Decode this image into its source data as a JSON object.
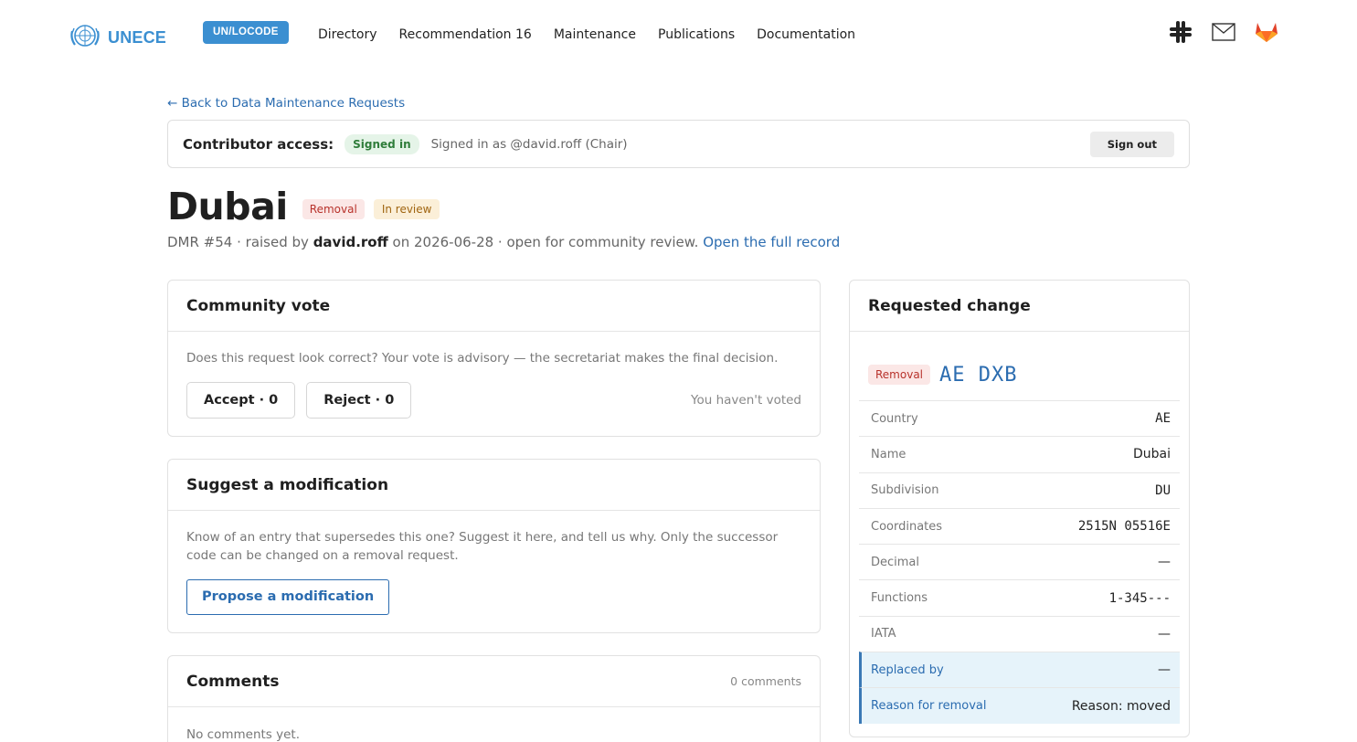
{
  "nav": {
    "logo_text": "UNECE",
    "badge": "UN/LOCODE",
    "links": [
      "Directory",
      "Recommendation 16",
      "Maintenance",
      "Publications",
      "Documentation"
    ],
    "icons": [
      "slack-icon",
      "mail-icon",
      "gitlab-icon"
    ]
  },
  "back_link": "← Back to Data Maintenance Requests",
  "access": {
    "label": "Contributor access:",
    "status": "Signed in",
    "user": "Signed in as @david.roff (Chair)",
    "signout": "Sign out"
  },
  "request": {
    "title": "Dubai",
    "type_badge": "Removal",
    "status_badge": "In review",
    "dmr": "DMR #54",
    "raised_by_prefix": " · raised by ",
    "author": "david.roff",
    "date_text": " on 2026-06-28 · open for community review. ",
    "record_link": "Open the full record"
  },
  "vote": {
    "title": "Community vote",
    "description": "Does this request look correct? Your vote is advisory — the secretariat makes the final decision.",
    "accept": "Accept · 0",
    "reject": "Reject · 0",
    "status": "You haven't voted"
  },
  "suggest": {
    "title": "Suggest a modification",
    "description": "Know of an entry that supersedes this one? Suggest it here, and tell us why. Only the successor code can be changed on a removal request.",
    "button": "Propose a modification"
  },
  "comments": {
    "title": "Comments",
    "count": "0 comments",
    "empty": "No comments yet."
  },
  "change": {
    "title": "Requested change",
    "badge": "Removal",
    "code": "AE DXB",
    "fields": [
      {
        "label": "Country",
        "value": "AE"
      },
      {
        "label": "Name",
        "value": "Dubai"
      },
      {
        "label": "Subdivision",
        "value": "DU"
      },
      {
        "label": "Coordinates",
        "value": "2515N 05516E"
      },
      {
        "label": "Decimal",
        "value": "—"
      },
      {
        "label": "Functions",
        "value": "1-345---"
      },
      {
        "label": "IATA",
        "value": "—"
      },
      {
        "label": "Replaced by",
        "value": "—"
      },
      {
        "label": "Reason for removal",
        "value": "Reason: moved"
      }
    ]
  },
  "colors": {
    "brand": "#3b8fd1",
    "link": "#2b6cb0",
    "removal": "#b8322b",
    "review": "#a06510",
    "signed_in": "#2f7d3a"
  }
}
